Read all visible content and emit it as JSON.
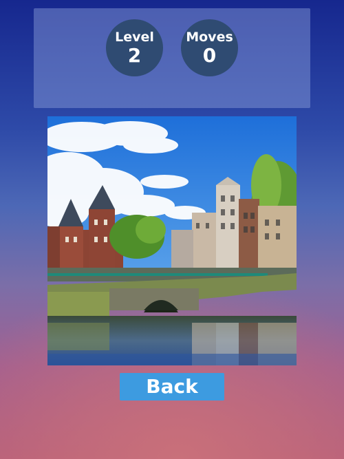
{
  "stats": {
    "level": {
      "label": "Level",
      "value": "2"
    },
    "moves": {
      "label": "Moves",
      "value": "0"
    }
  },
  "puzzle": {
    "image": "amsterdam-canal-photo"
  },
  "back_button": {
    "label": "Back"
  },
  "colors": {
    "stat_circle": "#2f4b72",
    "button": "#3d9be0",
    "panel": "#96aae1"
  }
}
